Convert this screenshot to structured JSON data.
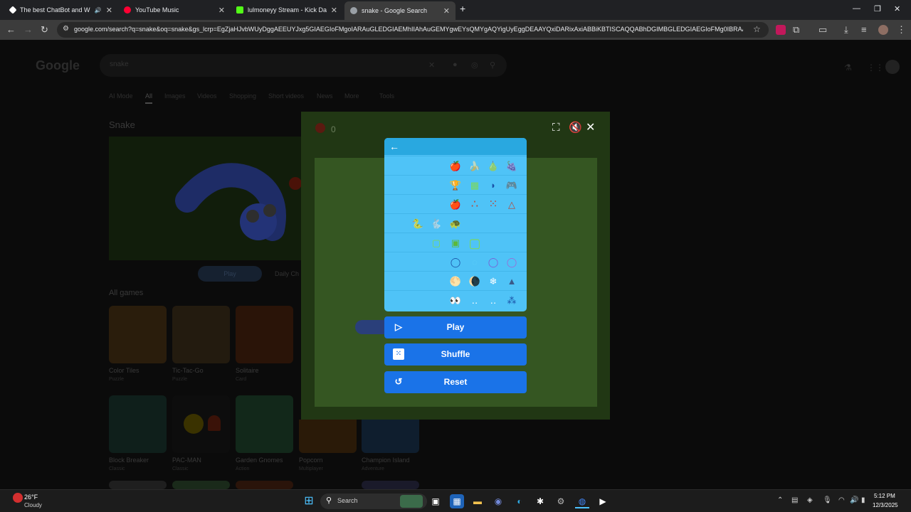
{
  "browser": {
    "tabs": [
      {
        "title": "The best ChatBot and Widg",
        "favicon_color": "#ffffff",
        "muted_audio": "🔊"
      },
      {
        "title": "YouTube Music",
        "favicon_color": "#ff0033"
      },
      {
        "title": "lulmoneyy Stream - Kick Dashb",
        "favicon_color": "#53fc18"
      },
      {
        "title": "snake - Google Search",
        "favicon_color": "#9aa0a6",
        "active": true
      }
    ],
    "new_tab_icon": "+",
    "url": "google.com/search?q=snake&oq=snake&gs_lcrp=EgZjaHJvbWUyDggAEEUYJxg5GIAEGIoFMgoIARAuGLEDGIAEMhIIAhAuGEMYgwEYsQMYgAQYigUyEggDEAAYQxiDARixAxiABBiKBTISCAQQABhDGIMBGLEDGIAEGIoFMg0IBRAAGI..."
  },
  "google": {
    "logo": "Google",
    "query": "snake",
    "tabs": [
      "AI Mode",
      "All",
      "Images",
      "Videos",
      "Shopping",
      "Short videos",
      "News",
      "More",
      "Tools"
    ],
    "result_title": "Snake",
    "play_label": "Play",
    "daily_label": "Daily Ch",
    "all_games_label": "All games",
    "games": [
      {
        "name": "Color Tiles",
        "category": "Puzzle",
        "color": "#c9862b"
      },
      {
        "name": "Tic-Tac-Go",
        "category": "Puzzle",
        "color": "#7a5a2a"
      },
      {
        "name": "Solitaire",
        "category": "Card",
        "color": "#b0521f"
      },
      {
        "name": "Block Breaker",
        "category": "Classic",
        "color": "#3a6c5b"
      },
      {
        "name": "PAC-MAN",
        "category": "Classic",
        "color": "#1b1b1b"
      },
      {
        "name": "Garden Gnomes",
        "category": "Action",
        "color": "#3b8a49"
      },
      {
        "name": "Popcorn",
        "category": "Multiplayer",
        "color": "#8a5a20"
      },
      {
        "name": "Champion Island",
        "category": "Adventure",
        "color": "#2e5a8a"
      }
    ]
  },
  "game": {
    "score": "0",
    "settings_rows": [
      [
        "🍎",
        "🍌",
        "🍐",
        "🍇"
      ],
      [
        "🏆",
        "▦",
        "◗",
        "🎮"
      ],
      [
        "🍎",
        "∴",
        "⁙",
        "△"
      ],
      [
        "🐍",
        "🐇",
        "🐢"
      ],
      [
        "▢",
        "▣",
        "▢"
      ],
      [
        "◯",
        "◌",
        "◯",
        "◯"
      ],
      [
        "🌕",
        "🌘",
        "❄",
        "▲"
      ],
      [
        "👀",
        "‥",
        "‥",
        "⁂"
      ]
    ],
    "play_label": "Play",
    "shuffle_label": "Shuffle",
    "reset_label": "Reset",
    "colors": {
      "panel": "#4fc3f7",
      "button": "#1a73e8",
      "board": "#355622"
    }
  },
  "taskbar": {
    "weather_temp": "26°F",
    "weather_desc": "Cloudy",
    "search_placeholder": "Search",
    "time": "5:12 PM",
    "date": "12/3/2025"
  }
}
